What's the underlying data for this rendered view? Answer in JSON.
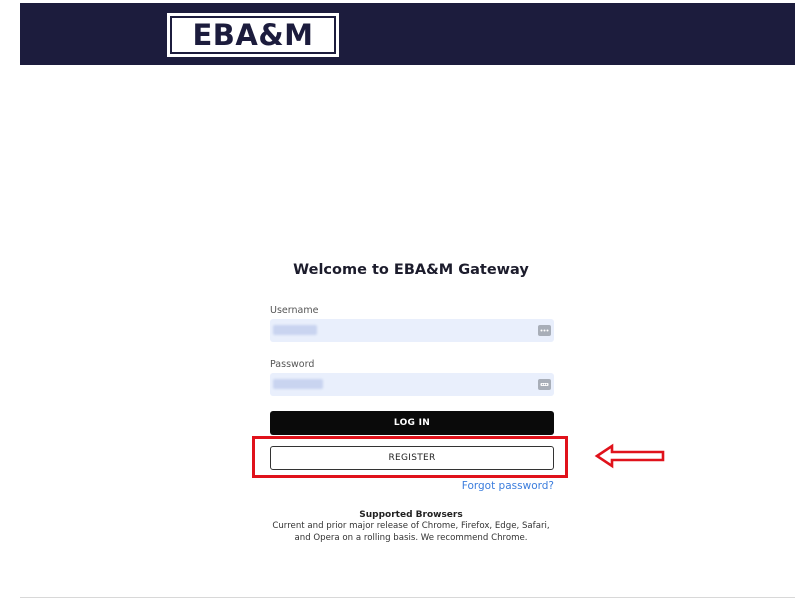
{
  "header": {
    "logo_text": "EBA&M",
    "background_color": "#1c1c3d"
  },
  "login": {
    "title": "Welcome to EBA&M Gateway",
    "username": {
      "label": "Username",
      "value": "",
      "icon": "password-manager-icon"
    },
    "password": {
      "label": "Password",
      "value": "",
      "icon": "password-manager-icon"
    },
    "login_button": "LOG IN",
    "register_button": "REGISTER",
    "forgot_link": "Forgot password?"
  },
  "annotation": {
    "highlight_color": "#e0121b",
    "arrow_icon": "left-arrow-icon"
  },
  "supported_browsers": {
    "title": "Supported Browsers",
    "text": "Current and prior major release of Chrome, Firefox, Edge, Safari, and Opera on a rolling basis. We recommend Chrome."
  }
}
